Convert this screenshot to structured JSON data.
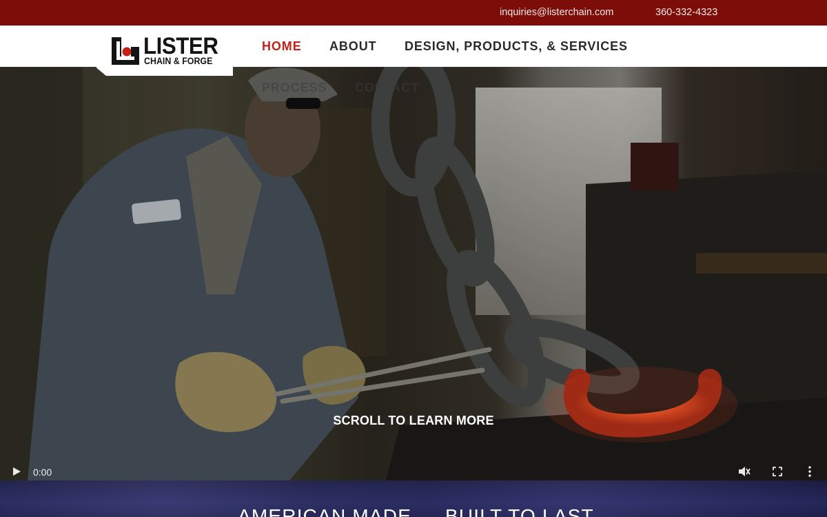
{
  "topbar": {
    "email": "inquiries@listerchain.com",
    "phone": "360-332-4323",
    "background": "#7d0d08"
  },
  "brand": {
    "logo_icon": "lister-logo-icon",
    "name": "LISTER",
    "tagline": "CHAIN & FORGE",
    "accent": "#c02218"
  },
  "nav": {
    "items": [
      {
        "label": "HOME",
        "active": true
      },
      {
        "label": "ABOUT",
        "active": false
      },
      {
        "label": "DESIGN, PRODUCTS, & SERVICES",
        "active": false
      },
      {
        "label": "PROCESS",
        "active": false
      },
      {
        "label": "CONTACT",
        "active": false
      }
    ]
  },
  "hero": {
    "cta": "SCROLL TO LEARN MORE",
    "video": {
      "time": "0:00",
      "play_icon": "play-icon",
      "mute_icon": "mute-icon",
      "fullscreen_icon": "fullscreen-icon",
      "more_icon": "more-vertical-icon"
    }
  },
  "band": {
    "left": "AMERICAN MADE",
    "right": "BUILT TO LAST",
    "background": "#1f2150"
  }
}
